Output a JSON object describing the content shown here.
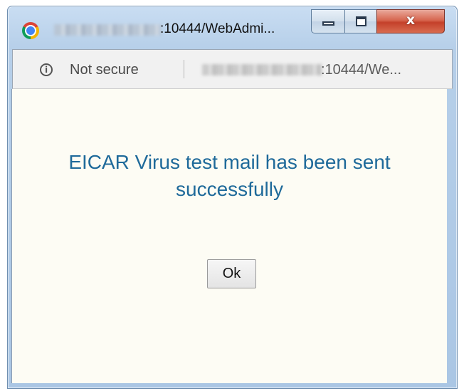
{
  "window": {
    "title": ":10444/WebAdmi...",
    "controls": {
      "minimize": "minimize",
      "maximize": "maximize",
      "close_glyph": "x"
    }
  },
  "addressbar": {
    "security_icon": "info-icon",
    "security_label": "Not secure",
    "url": ":10444/We..."
  },
  "dialog": {
    "message": "EICAR Virus test mail has been sent successfully",
    "ok_label": "Ok"
  },
  "colors": {
    "message_text": "#1f6a9a",
    "content_background": "#fdfcf4",
    "close_button": "#c4402a"
  }
}
